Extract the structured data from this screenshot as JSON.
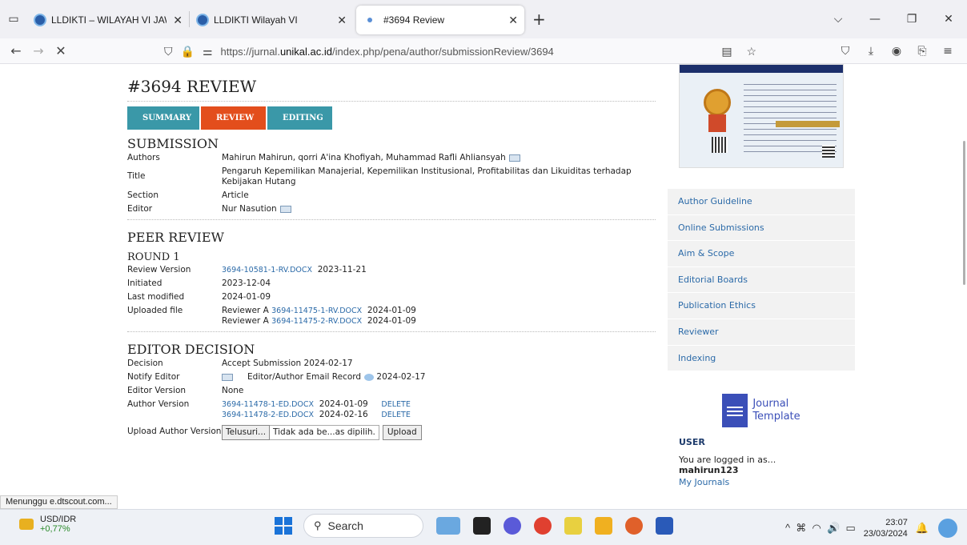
{
  "browser": {
    "tabs": [
      {
        "title": "LLDIKTI – WILAYAH VI JAWA TE",
        "active": false
      },
      {
        "title": "LLDIKTI Wilayah VI",
        "active": false
      },
      {
        "title": "#3694 Review",
        "active": true
      }
    ],
    "url_prefix": "https://jurnal.",
    "url_host": "unikal.ac.id",
    "url_path": "/index.php/pena/author/submissionReview/3694",
    "status": "Menunggu e.dtscout.com..."
  },
  "page": {
    "title": "#3694 REVIEW",
    "menu": {
      "summary": "SUMMARY",
      "review": "REVIEW",
      "editing": "EDITING"
    },
    "submission": {
      "heading": "SUBMISSION",
      "authors_label": "Authors",
      "authors": "Mahirun Mahirun, qorri A'ina Khofiyah, Muhammad Rafli Ahliansyah",
      "title_label": "Title",
      "title": "Pengaruh Kepemilikan Manajerial, Kepemilikan Institusional, Profitabilitas dan Likuiditas terhadap Kebijakan Hutang",
      "section_label": "Section",
      "section": "Article",
      "editor_label": "Editor",
      "editor": "Nur Nasution"
    },
    "peer_review": {
      "heading": "PEER REVIEW",
      "round": "ROUND 1",
      "review_version_label": "Review Version",
      "review_version_file": "3694-10581-1-RV.DOCX",
      "review_version_date": "2023-11-21",
      "initiated_label": "Initiated",
      "initiated": "2023-12-04",
      "last_modified_label": "Last modified",
      "last_modified": "2024-01-09",
      "uploaded_label": "Uploaded file",
      "uploads": [
        {
          "reviewer": "Reviewer A",
          "file": "3694-11475-1-RV.DOCX",
          "date": "2024-01-09"
        },
        {
          "reviewer": "Reviewer A",
          "file": "3694-11475-2-RV.DOCX",
          "date": "2024-01-09"
        }
      ]
    },
    "editor_decision": {
      "heading": "EDITOR DECISION",
      "decision_label": "Decision",
      "decision": "Accept Submission 2024-02-17",
      "notify_label": "Notify Editor",
      "notify_text": "Editor/Author Email Record",
      "notify_date": "2024-02-17",
      "editor_version_label": "Editor Version",
      "editor_version": "None",
      "author_version_label": "Author Version",
      "author_versions": [
        {
          "file": "3694-11478-1-ED.DOCX",
          "date": "2024-01-09",
          "action": "DELETE"
        },
        {
          "file": "3694-11478-2-ED.DOCX",
          "date": "2024-02-16",
          "action": "DELETE"
        }
      ],
      "upload_label": "Upload Author Version",
      "browse": "Telusuri...",
      "no_file": "Tidak ada be...as dipilih.",
      "upload_btn": "Upload"
    }
  },
  "sidebar": {
    "nav": [
      "Author Guideline",
      "Online Submissions",
      "Aim & Scope",
      "Editorial Boards",
      "Publication Ethics",
      "Reviewer",
      "Indexing"
    ],
    "journal_template": {
      "line1": "Journal",
      "line2": "Template"
    },
    "user": {
      "heading": "USER",
      "logged_in": "You are logged in as...",
      "name": "mahirun123",
      "my_journals": "My Journals"
    }
  },
  "taskbar": {
    "ticker_name": "USD/IDR",
    "ticker_change": "+0,77%",
    "search": "Search",
    "time": "23:07",
    "date": "23/03/2024"
  }
}
